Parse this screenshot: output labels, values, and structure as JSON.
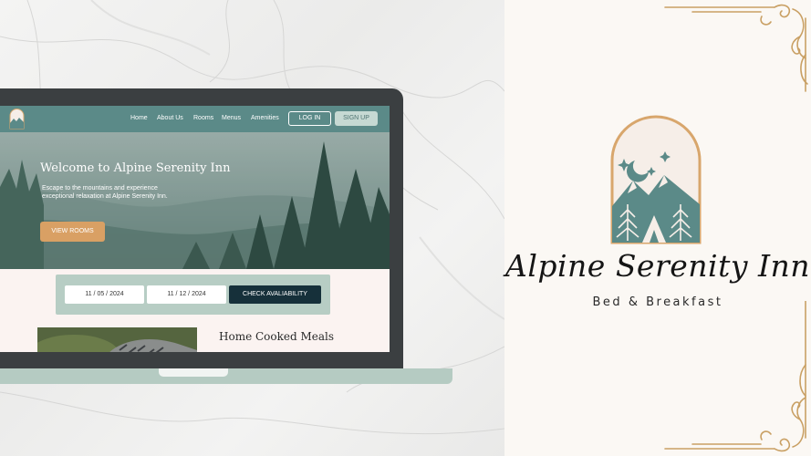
{
  "website": {
    "nav": {
      "links": [
        "Home",
        "About Us",
        "Rooms",
        "Menus",
        "Amenities"
      ],
      "login_label": "LOG IN",
      "signup_label": "SIGN UP"
    },
    "hero": {
      "title": "Welcome to Alpine Serenity Inn",
      "text": "Escape to the mountains and experience exceptional relaxation at Alpine Serenity Inn.",
      "button_label": "VIEW ROOMS"
    },
    "booking": {
      "checkin_date": "11 / 05 / 2024",
      "checkout_date": "11 / 12 / 2024",
      "check_button_label": "CHECK AVALIABILITY"
    },
    "section": {
      "heading": "Home Cooked Meals"
    }
  },
  "brand": {
    "name": "Alpine Serenity Inn",
    "tagline": "Bed & Breakfast"
  },
  "colors": {
    "teal": "#5b8a88",
    "sage": "#b7cdc4",
    "accent_orange": "#d9a064",
    "navy": "#16303a",
    "gold": "#c9a064"
  },
  "icons": {
    "emblem": "mountain-moon-stars-emblem",
    "ornament": "gold-flourish-ornament"
  }
}
